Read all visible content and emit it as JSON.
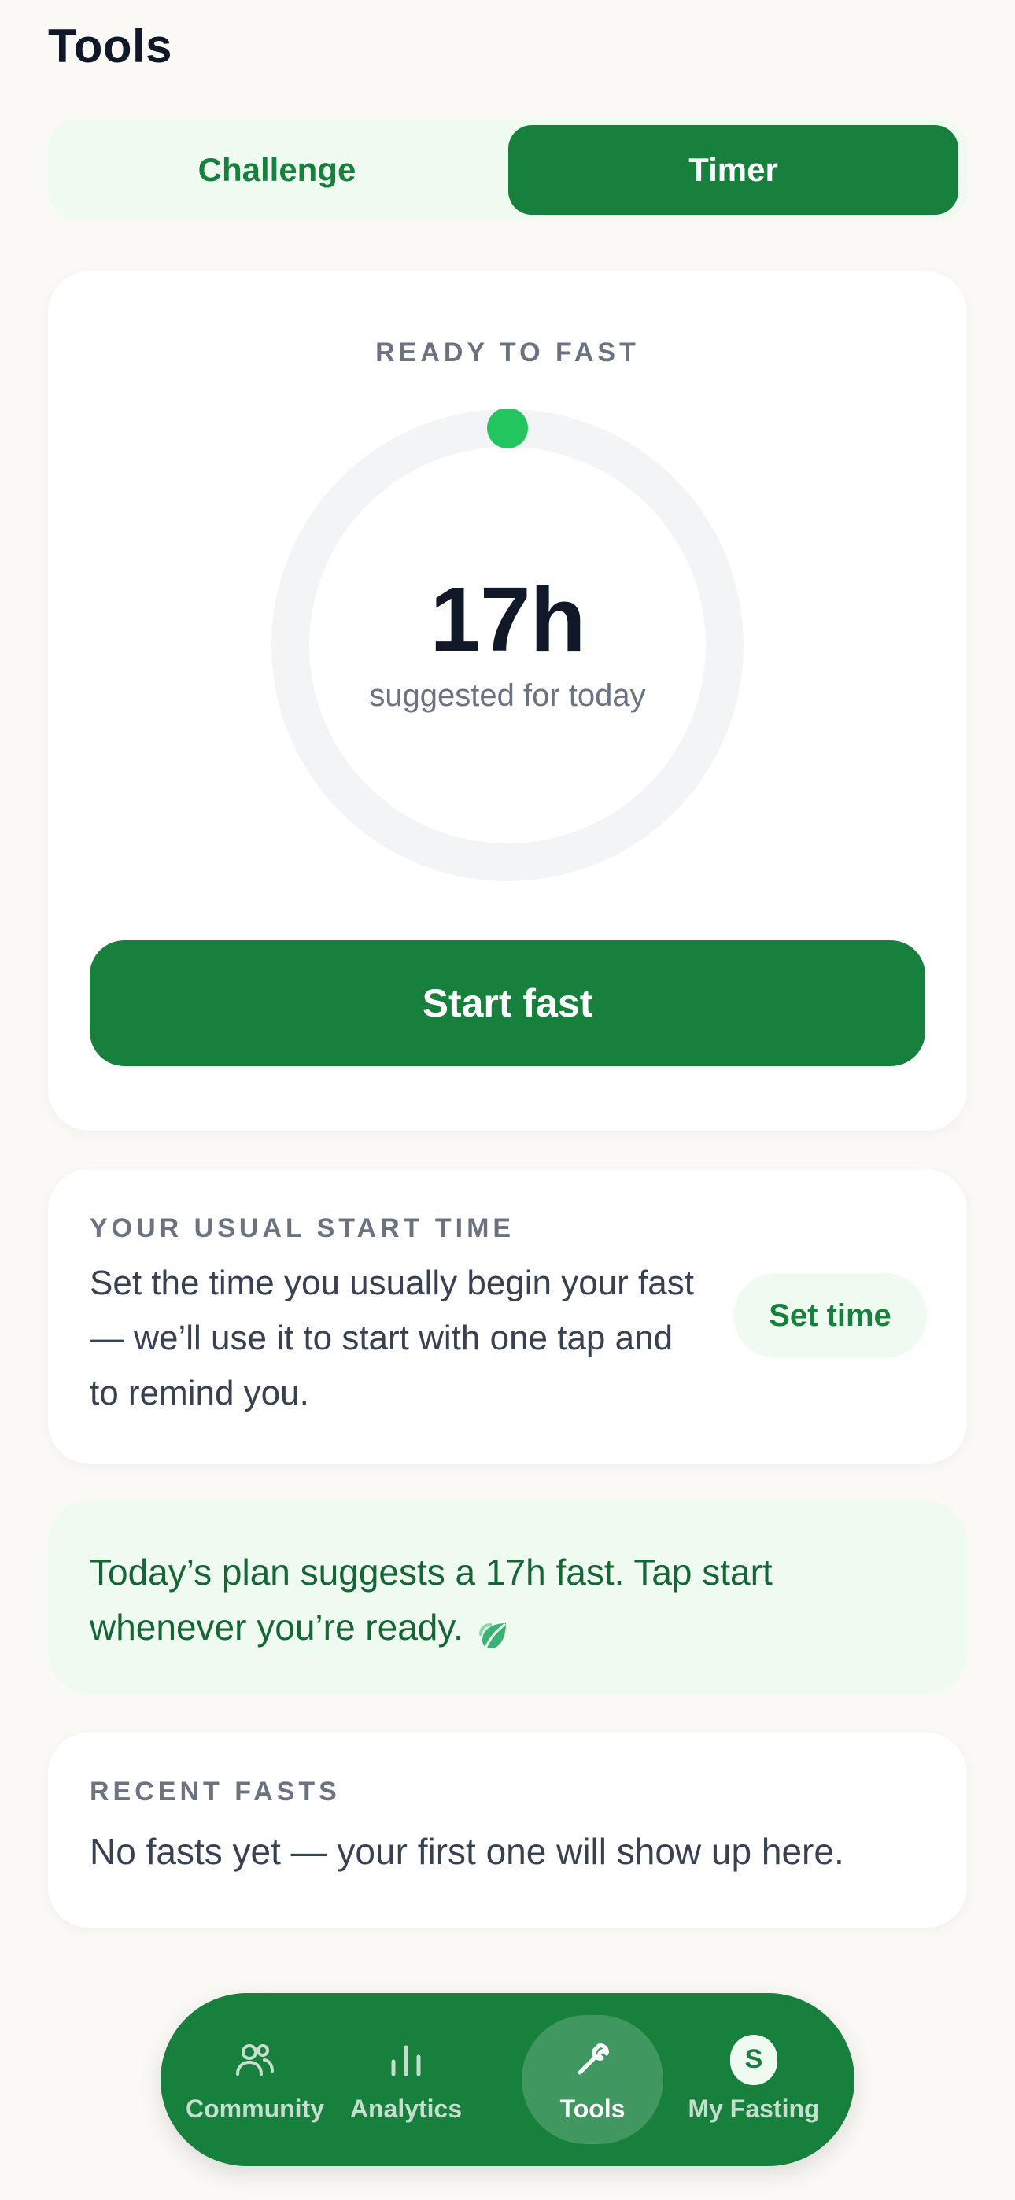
{
  "header": {
    "title": "Tools"
  },
  "segmented": {
    "challenge_label": "Challenge",
    "timer_label": "Timer",
    "selected": "Timer"
  },
  "timer_card": {
    "status_label": "READY TO FAST",
    "hours_value": "17h",
    "caption": "suggested for today",
    "progress": 0,
    "start_button_label": "Start fast"
  },
  "start_time_card": {
    "label": "YOUR USUAL START TIME",
    "description": "Set the time you usually begin your fast — we’ll use it to start with one tap and to remind you.",
    "button_label": "Set time"
  },
  "plan_card": {
    "text": "Today’s plan suggests a 17h fast. Tap start whenever you’re ready.",
    "icon": "leaf-icon"
  },
  "recent_card": {
    "label": "RECENT FASTS",
    "empty_text": "No fasts yet — your first one will show up here."
  },
  "bottom_nav": {
    "items": [
      {
        "label": "Community",
        "icon": "community-icon"
      },
      {
        "label": "Analytics",
        "icon": "analytics-icon"
      },
      {
        "label": "Tools",
        "icon": "wrench-icon",
        "active": true
      },
      {
        "label": "My Fasting",
        "icon": "avatar",
        "avatar_initial": "S"
      }
    ]
  },
  "colors": {
    "primary": "#17803d",
    "primary_light": "#effbf1",
    "progress_dot": "#22c55e",
    "ring_track": "#f3f4f6"
  }
}
